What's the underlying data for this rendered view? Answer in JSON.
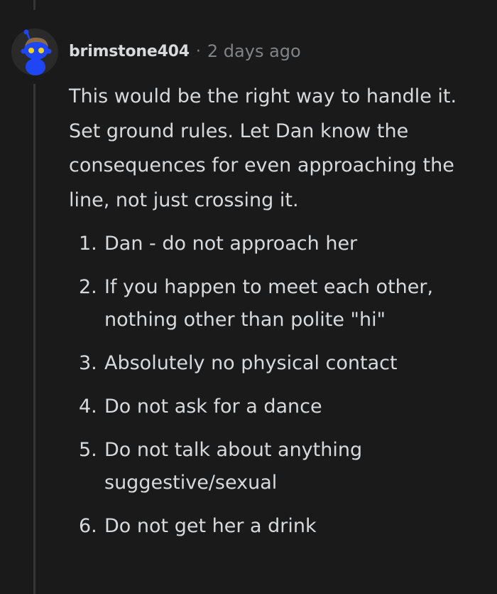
{
  "comment": {
    "username": "brimstone404",
    "separator": "·",
    "timestamp": "2 days ago",
    "avatar_icon": "reddit-snoo-avatar-icon",
    "body": "This would be the right way to handle it. Set ground rules. Let Dan know the consequences for even approaching the line, not just crossing it.",
    "rules": [
      {
        "num": "1.",
        "text": "Dan - do not approach her"
      },
      {
        "num": "2.",
        "text": "If you happen to meet each other, nothing other than polite \"hi\""
      },
      {
        "num": "3.",
        "text": "Absolutely no physical contact"
      },
      {
        "num": "4.",
        "text": "Do not ask for a dance"
      },
      {
        "num": "5.",
        "text": "Do not talk about anything suggestive/sexual"
      },
      {
        "num": "6.",
        "text": "Do not get her a drink"
      }
    ]
  },
  "colors": {
    "background": "#1a1a1b",
    "text": "#d7dadc",
    "muted": "#818384",
    "thread_line": "#343536",
    "avatar_blue": "#1e46f5",
    "avatar_bg": "#2a2a2b"
  }
}
